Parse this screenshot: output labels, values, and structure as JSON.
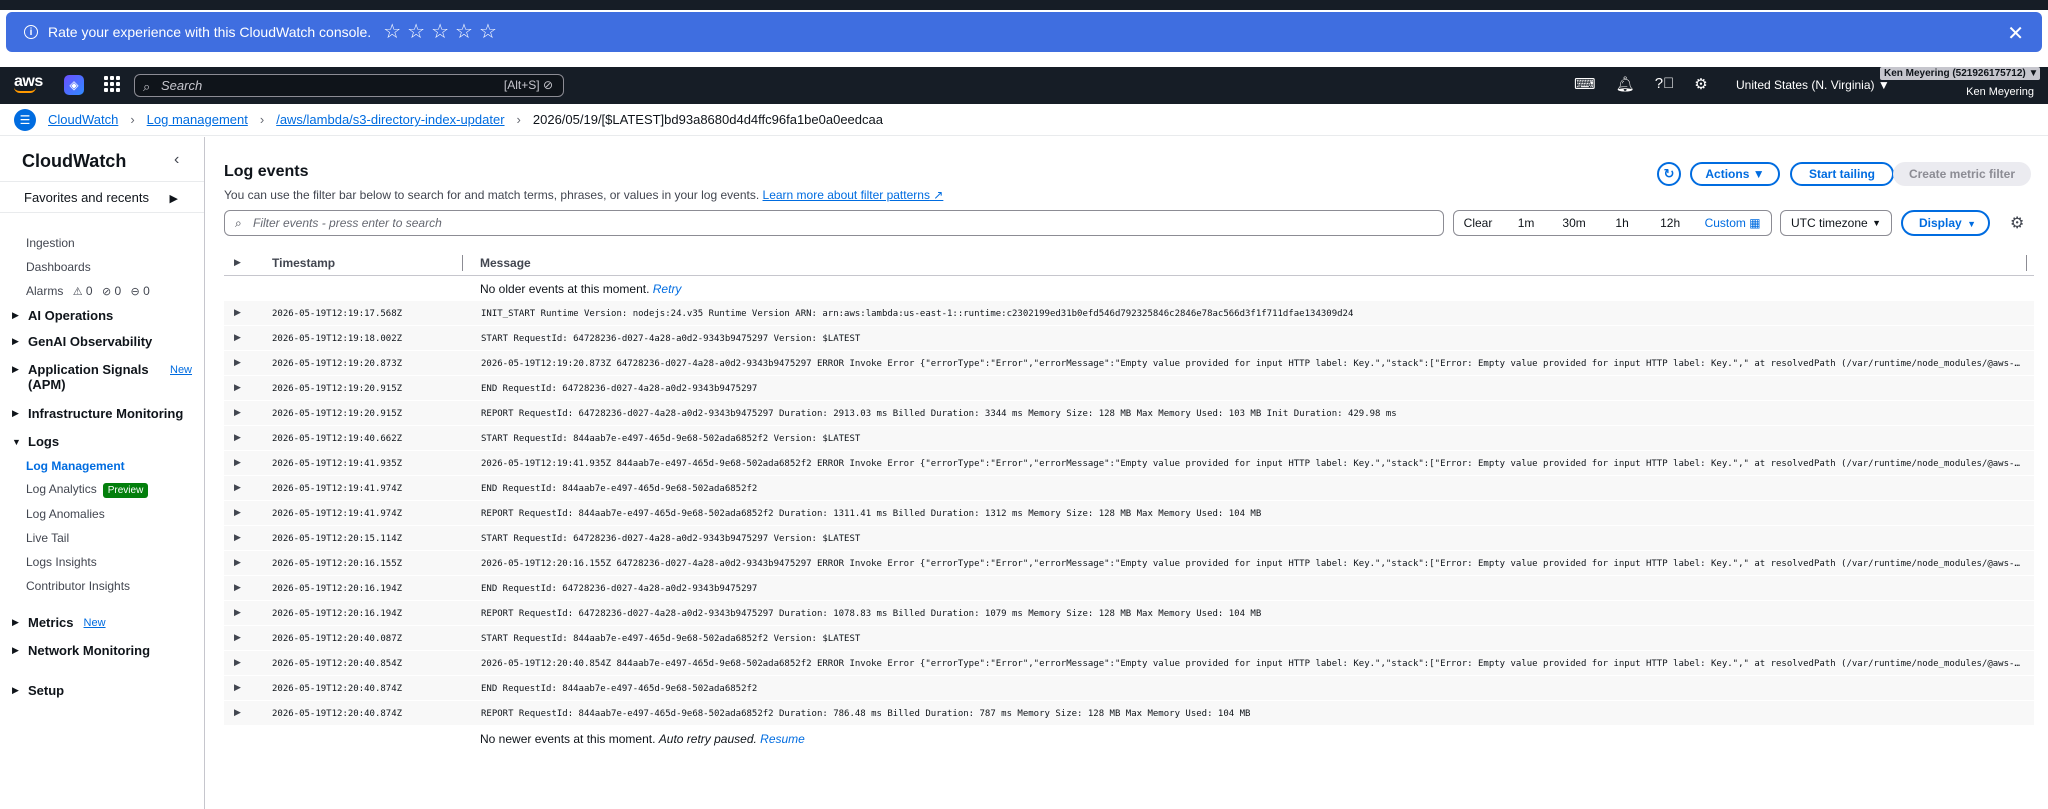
{
  "banner": {
    "text": "Rate your experience with this CloudWatch console.",
    "star_count": 5
  },
  "nav": {
    "logo": "aws",
    "search_placeholder": "Search",
    "search_shortcut": "[Alt+S]",
    "region": "United States (N. Virginia) ▼",
    "account": "Ken Meyering (521926175712) ▼",
    "user": "Ken Meyering"
  },
  "breadcrumbs": {
    "items": [
      "CloudWatch",
      "Log management",
      "/aws/lambda/s3-directory-index-updater"
    ],
    "current": "2026/05/19/[$LATEST]bd93a8680d4d4ffc96fa1be0a0eedcaa"
  },
  "sidebar": {
    "title": "CloudWatch",
    "favorites": "Favorites and recents",
    "ingestion": "Ingestion",
    "dashboards": "Dashboards",
    "alarms": "Alarms",
    "alarm_counts": [
      "0",
      "0",
      "0"
    ],
    "ai_operations": "AI Operations",
    "genai": "GenAI Observability",
    "app_signals": "Application Signals",
    "app_signals_sub": "(APM)",
    "new_label": "New",
    "infra": "Infrastructure Monitoring",
    "logs": "Logs",
    "log_management": "Log Management",
    "log_analytics": "Log Analytics",
    "preview_label": "Preview",
    "log_anomalies": "Log Anomalies",
    "live_tail": "Live Tail",
    "logs_insights": "Logs Insights",
    "contributor": "Contributor Insights",
    "metrics": "Metrics",
    "network": "Network Monitoring",
    "setup": "Setup"
  },
  "main": {
    "title": "Log events",
    "subtitle": "You can use the filter bar below to search for and match terms, phrases, or values in your log events.",
    "learn_more": "Learn more about filter patterns",
    "actions": "Actions ▼",
    "start_tailing": "Start tailing",
    "create_metric_filter": "Create metric filter",
    "filter_placeholder": "Filter events - press enter to search",
    "time_options": [
      "Clear",
      "1m",
      "30m",
      "1h",
      "12h",
      "Custom ▦"
    ],
    "timezone": "UTC timezone",
    "display": "Display",
    "col_timestamp": "Timestamp",
    "col_message": "Message",
    "no_older": "No older events at this moment.",
    "retry": "Retry",
    "no_newer": "No newer events at this moment.",
    "auto_retry": "Auto retry paused.",
    "resume": "Resume"
  },
  "rows": [
    {
      "ts": "2026-05-19T12:19:17.568Z",
      "msg": "INIT_START Runtime Version: nodejs:24.v35 Runtime Version ARN: arn:aws:lambda:us-east-1::runtime:c2302199ed31b0efd546d792325846c2846e78ac566d3f1f711dfae134309d24"
    },
    {
      "ts": "2026-05-19T12:19:18.002Z",
      "msg": "START RequestId: 64728236-d027-4a28-a0d2-9343b9475297 Version: $LATEST"
    },
    {
      "ts": "2026-05-19T12:19:20.873Z",
      "msg": "2026-05-19T12:19:20.873Z 64728236-d027-4a28-a0d2-9343b9475297 ERROR Invoke Error {\"errorType\":\"Error\",\"errorMessage\":\"Empty value provided for input HTTP label: Key.\",\"stack\":[\"Error: Empty value provided for input HTTP label: Key.\",\" at resolvedPath (/var/runtime/node_modules/@aws-sdk/node_modules/@smithy/core/dist-cjs/index.js\"]}"
    },
    {
      "ts": "2026-05-19T12:19:20.915Z",
      "msg": "END RequestId: 64728236-d027-4a28-a0d2-9343b9475297"
    },
    {
      "ts": "2026-05-19T12:19:20.915Z",
      "msg": "REPORT RequestId: 64728236-d027-4a28-a0d2-9343b9475297 Duration: 2913.03 ms Billed Duration: 3344 ms Memory Size: 128 MB Max Memory Used: 103 MB Init Duration: 429.98 ms"
    },
    {
      "ts": "2026-05-19T12:19:40.662Z",
      "msg": "START RequestId: 844aab7e-e497-465d-9e68-502ada6852f2 Version: $LATEST"
    },
    {
      "ts": "2026-05-19T12:19:41.935Z",
      "msg": "2026-05-19T12:19:41.935Z 844aab7e-e497-465d-9e68-502ada6852f2 ERROR Invoke Error {\"errorType\":\"Error\",\"errorMessage\":\"Empty value provided for input HTTP label: Key.\",\"stack\":[\"Error: Empty value provided for input HTTP label: Key.\",\" at resolvedPath (/var/runtime/node_modules/@aws-sdk/node_modules/@smithy/core/dist-cjs/index.js\"]}"
    },
    {
      "ts": "2026-05-19T12:19:41.974Z",
      "msg": "END RequestId: 844aab7e-e497-465d-9e68-502ada6852f2"
    },
    {
      "ts": "2026-05-19T12:19:41.974Z",
      "msg": "REPORT RequestId: 844aab7e-e497-465d-9e68-502ada6852f2 Duration: 1311.41 ms Billed Duration: 1312 ms Memory Size: 128 MB Max Memory Used: 104 MB"
    },
    {
      "ts": "2026-05-19T12:20:15.114Z",
      "msg": "START RequestId: 64728236-d027-4a28-a0d2-9343b9475297 Version: $LATEST"
    },
    {
      "ts": "2026-05-19T12:20:16.155Z",
      "msg": "2026-05-19T12:20:16.155Z 64728236-d027-4a28-a0d2-9343b9475297 ERROR Invoke Error {\"errorType\":\"Error\",\"errorMessage\":\"Empty value provided for input HTTP label: Key.\",\"stack\":[\"Error: Empty value provided for input HTTP label: Key.\",\" at resolvedPath (/var/runtime/node_modules/@aws-sdk/node_modules/@smithy/core/dist-cjs/index.js\"]}"
    },
    {
      "ts": "2026-05-19T12:20:16.194Z",
      "msg": "END RequestId: 64728236-d027-4a28-a0d2-9343b9475297"
    },
    {
      "ts": "2026-05-19T12:20:16.194Z",
      "msg": "REPORT RequestId: 64728236-d027-4a28-a0d2-9343b9475297 Duration: 1078.83 ms Billed Duration: 1079 ms Memory Size: 128 MB Max Memory Used: 104 MB"
    },
    {
      "ts": "2026-05-19T12:20:40.087Z",
      "msg": "START RequestId: 844aab7e-e497-465d-9e68-502ada6852f2 Version: $LATEST"
    },
    {
      "ts": "2026-05-19T12:20:40.854Z",
      "msg": "2026-05-19T12:20:40.854Z 844aab7e-e497-465d-9e68-502ada6852f2 ERROR Invoke Error {\"errorType\":\"Error\",\"errorMessage\":\"Empty value provided for input HTTP label: Key.\",\"stack\":[\"Error: Empty value provided for input HTTP label: Key.\",\" at resolvedPath (/var/runtime/node_modules/@aws-sdk/node_modules/@smithy/core/dist-cjs/index.js\"]}"
    },
    {
      "ts": "2026-05-19T12:20:40.874Z",
      "msg": "END RequestId: 844aab7e-e497-465d-9e68-502ada6852f2"
    },
    {
      "ts": "2026-05-19T12:20:40.874Z",
      "msg": "REPORT RequestId: 844aab7e-e497-465d-9e68-502ada6852f2 Duration: 786.48 ms Billed Duration: 787 ms Memory Size: 128 MB Max Memory Used: 104 MB"
    }
  ]
}
